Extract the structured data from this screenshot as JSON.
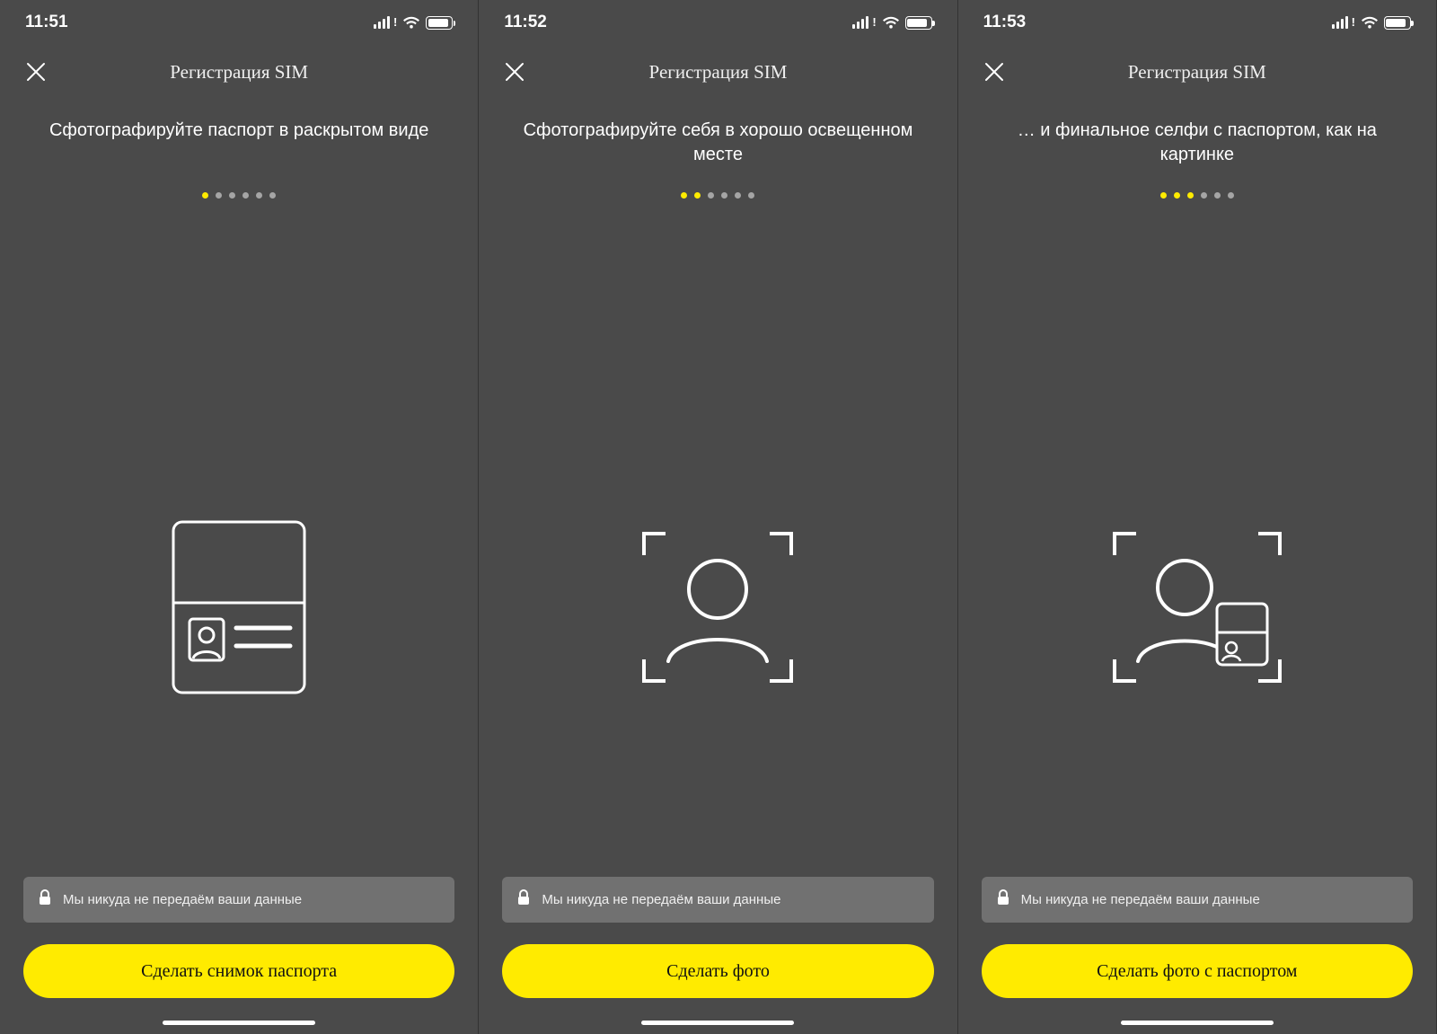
{
  "screens": [
    {
      "status": {
        "time": "11:51"
      },
      "nav_title": "Регистрация SIM",
      "instruction": "Сфотографируйте паспорт в раскрытом виде",
      "dots": {
        "total": 6,
        "active": [
          1
        ]
      },
      "illustration": "passport",
      "privacy": "Мы никуда не передаём ваши данные",
      "button_label": "Сделать снимок паспорта"
    },
    {
      "status": {
        "time": "11:52"
      },
      "nav_title": "Регистрация SIM",
      "instruction": "Сфотографируйте себя в хорошо освещенном месте",
      "dots": {
        "total": 6,
        "active": [
          1,
          2
        ]
      },
      "illustration": "selfie",
      "privacy": "Мы никуда не передаём ваши данные",
      "button_label": "Сделать фото"
    },
    {
      "status": {
        "time": "11:53"
      },
      "nav_title": "Регистрация SIM",
      "instruction": "… и финальное селфи с паспортом, как на картинке",
      "dots": {
        "total": 6,
        "active": [
          1,
          2,
          3
        ]
      },
      "illustration": "selfie_passport",
      "privacy": "Мы никуда не передаём ваши данные",
      "button_label": "Сделать фото с паспортом"
    }
  ],
  "colors": {
    "bg": "#4a4a4a",
    "accent": "#ffeb00"
  }
}
